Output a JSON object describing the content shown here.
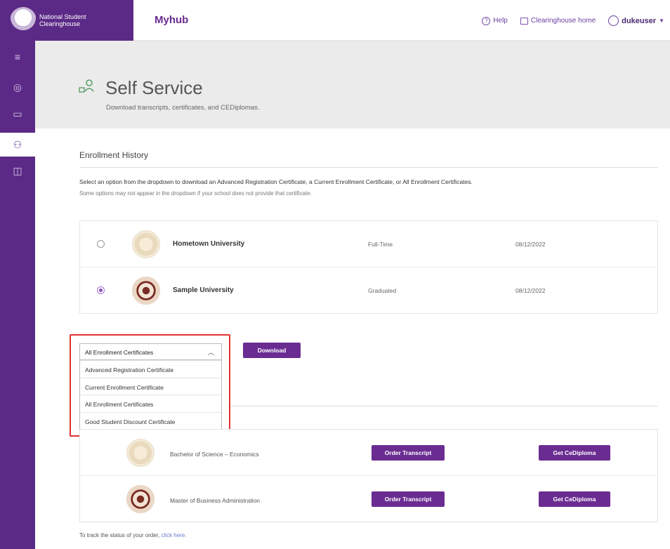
{
  "header": {
    "brand_line1": "National Student",
    "brand_line2": "Clearinghouse",
    "app_title": "Myhub",
    "help": "Help",
    "clearinghouse_home": "Clearinghouse home",
    "username": "dukeuser",
    "icons": [
      "help-circle-icon",
      "external-link-icon",
      "user-circle-icon",
      "caret-down-icon"
    ]
  },
  "sidebar": {
    "items": [
      {
        "name": "menu",
        "glyph": "≡"
      },
      {
        "name": "dashboard",
        "glyph": "◎"
      },
      {
        "name": "folder",
        "glyph": "▭"
      },
      {
        "name": "self-service",
        "glyph": "⚇",
        "active": true
      },
      {
        "name": "documents",
        "glyph": "◫"
      }
    ]
  },
  "hero": {
    "title": "Self Service",
    "subtitle": "Download transcripts, certificates, and CEDiplomas."
  },
  "enrollment": {
    "title": "Enrollment History",
    "instruction": "Select an option from the dropdown to download an Advanced Registration Certificate, a Current Enrollment Certificate, or All Enrollment Certificates.",
    "note": "Some options may not appear in the dropdown if your school does not provide that certificate.",
    "rows": [
      {
        "school": "Hometown University",
        "status": "Full-Time",
        "date": "08/12/2022",
        "selected": false
      },
      {
        "school": "Sample University",
        "status": "Graduated",
        "date": "08/12/2022",
        "selected": true
      }
    ],
    "select_value": "All Enrollment Certificates",
    "options": [
      "Advanced Registration Certificate",
      "Current Enrollment Certificate",
      "All Enrollment Certificates",
      "Good Student Discount Certificate"
    ],
    "download_label": "Download"
  },
  "degrees": {
    "rows": [
      {
        "degree": "Bachelor of Science – Economics",
        "order_label": "Order Transcript",
        "diploma_label": "Get CeDiploma"
      },
      {
        "degree": "Master of Business Administration",
        "order_label": "Order Transcript",
        "diploma_label": "Get CeDiploma"
      }
    ]
  },
  "footer": {
    "track_text": "To track the status of your order,",
    "track_link": "click here."
  },
  "colors": {
    "brand_purple": "#5b2a86",
    "button_purple": "#6a2c91",
    "highlight_red": "#e03131"
  }
}
